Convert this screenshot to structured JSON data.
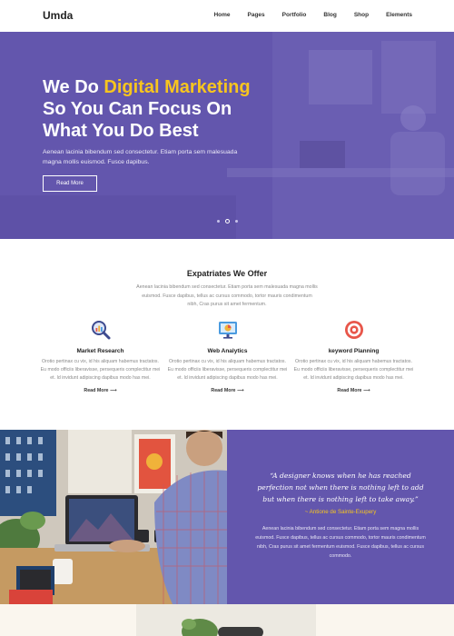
{
  "nav": {
    "logo": "Umda",
    "items": [
      {
        "label": "Home"
      },
      {
        "label": "Pages"
      },
      {
        "label": "Portfolio"
      },
      {
        "label": "Blog"
      },
      {
        "label": "Shop"
      },
      {
        "label": "Elements"
      }
    ]
  },
  "hero": {
    "title_pre": "We Do ",
    "title_accent": "Digital Marketing",
    "title_line2": "So You Can Focus On",
    "title_line3": "What You Do Best",
    "subtitle": "Aenean lacinia bibendum sed consectetur. Etiam porta sem malesuada magna mollis euismod. Fusce dapibus.",
    "button": "Read More",
    "slides": 3,
    "active_slide": 2
  },
  "services": {
    "title": "Expatriates We Offer",
    "description": "Aenean lacinia bibendum sed consectetur. Etiam porta sem malesuada magna mollis euismod. Fusce dapibus, tellus ac cursus commodo, tortor mauris condimentum nibh, Cras purus sit amet fermentum.",
    "items": [
      {
        "icon": "magnifier-chart-icon",
        "name": "Market Research",
        "desc": "Orotio pertinax cu vix, id his aliquam habemus tractatos. Eu modo officiis liberavisse, persequeris complectitur mei et. Id invidunt adipiscing dapibus modo has mei.",
        "link": "Read More"
      },
      {
        "icon": "monitor-chart-icon",
        "name": "Web Analytics",
        "desc": "Orotio pertinax cu vix, id his aliquam habemus tractatos. Eu modo officiis liberavisse, persequeris complectitur mei et. Id invidunt adipiscing dapibus modo has mei.",
        "link": "Read More"
      },
      {
        "icon": "target-icon",
        "name": "keyword Planning",
        "desc": "Orotio pertinax cu vix, id his aliquam habemus tractatos. Eu modo officiis liberavisse, persequeris complectitur mei et. Id invidunt adipiscing dapibus modo has mei.",
        "link": "Read More"
      }
    ]
  },
  "testimonial": {
    "quote": "“A designer knows when he has reached perfection not when there is nothing left to add but when there is nothing left to take away.”",
    "author": "~ Antione de Sainte-Exupery",
    "description": "Aenean lacinia bibendum sed consectetur. Etiam porta sem magna mollis euismod. Fusce dapibus, tellus ac cursus commodo, tortor mauris condimentum nibh, Cras purus sit amet fermentum euismod. Fusce dapibus, tellus ac cursus commodo."
  },
  "colors": {
    "brand_purple": "#6356ad",
    "accent_yellow": "#f7c51e"
  }
}
